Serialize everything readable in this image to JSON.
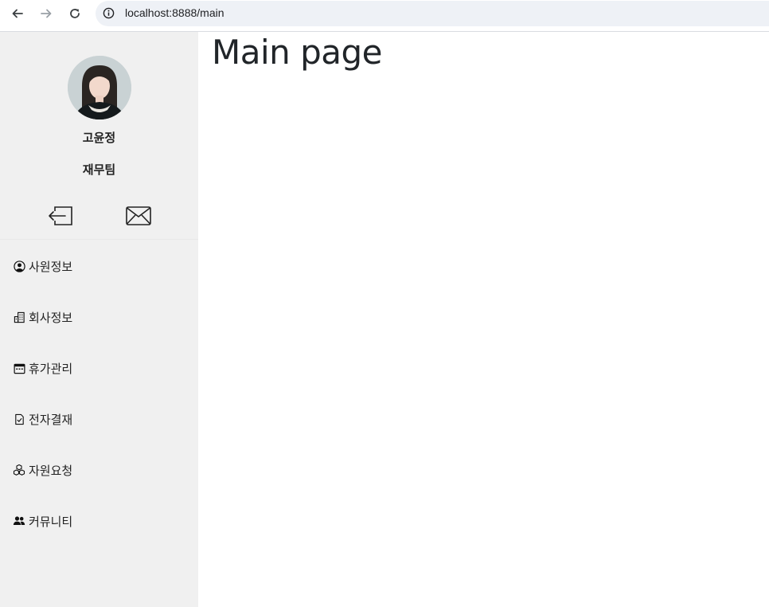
{
  "browser": {
    "url": "localhost:8888/main",
    "icons": [
      "back-arrow-icon",
      "forward-arrow-icon",
      "reload-icon",
      "info-icon"
    ]
  },
  "profile": {
    "name": "고윤정",
    "team": "재무팀"
  },
  "actions": [
    {
      "icon": "logout-icon"
    },
    {
      "icon": "mail-icon"
    }
  ],
  "menu": [
    {
      "label": "사원정보",
      "icon": "user-circle-icon"
    },
    {
      "label": "회사정보",
      "icon": "building-icon"
    },
    {
      "label": "휴가관리",
      "icon": "calendar-icon"
    },
    {
      "label": "전자결재",
      "icon": "document-check-icon"
    },
    {
      "label": "자원요청",
      "icon": "boxes-icon"
    },
    {
      "label": "커뮤니티",
      "icon": "people-icon"
    }
  ],
  "main": {
    "title": "Main page"
  },
  "colors": {
    "sidebar_bg": "#f0f0f0",
    "address_bar_bg": "#eef1f6",
    "text": "#222222"
  }
}
